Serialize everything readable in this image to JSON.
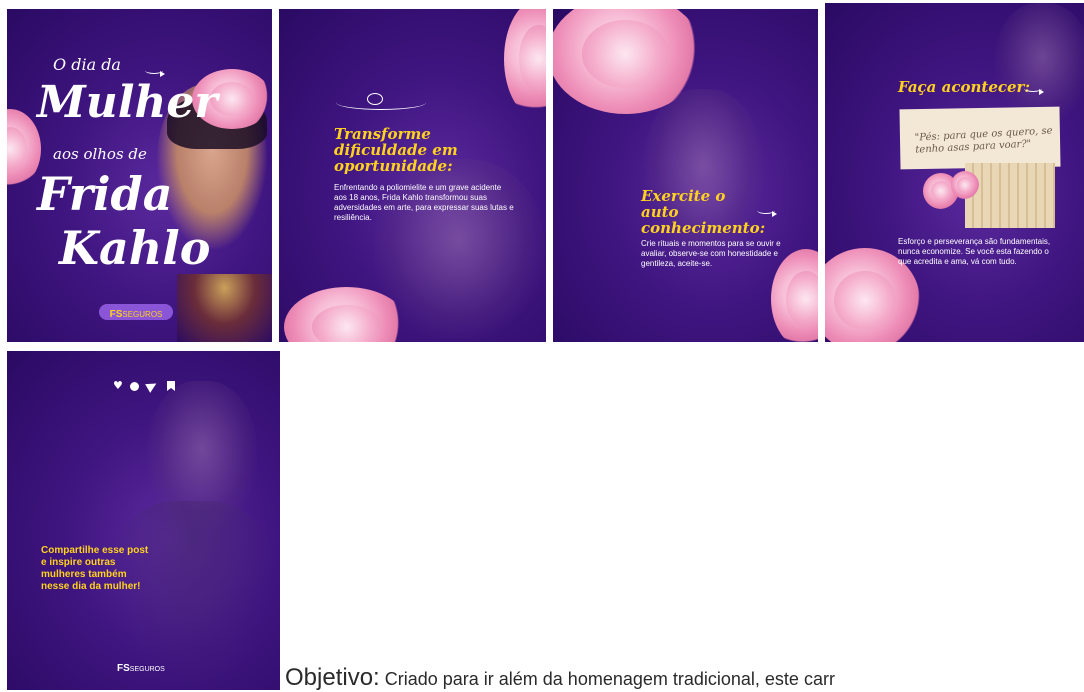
{
  "slide1": {
    "line1": "O dia da",
    "line2": "Mulher",
    "line3": "aos olhos de",
    "line4": "Frida",
    "line5": "Kahlo",
    "logo_fs": "FS",
    "logo_seguros": "SEGUROS"
  },
  "slide2": {
    "heading": "Transforme dificuldade em oportunidade:",
    "body": "Enfrentando a poliomielite e um grave acidente aos 18 anos, Frida Kahlo transformou suas adversidades em arte, para expressar suas lutas e resiliência."
  },
  "slide3": {
    "heading": "Exercite o auto conhecimento:",
    "body": "Crie rituais e momentos para se ouvir e avaliar, observe-se com honestidade e gentileza, aceite-se."
  },
  "slide4": {
    "heading": "Faça acontecer:",
    "quote": "\"Pés: para que os quero, se tenho asas para voar?\"",
    "body": "Esforço e perseverança são fundamentais, nunca economize. Se você esta fazendo o que acredita e ama, vá com tudo."
  },
  "slide5": {
    "icons": [
      "heart-icon",
      "comment-icon",
      "send-icon",
      "bookmark-icon"
    ],
    "cta": "Compartilhe esse post e inspire outras mulheres também nesse dia da mulher!",
    "logo_fs": "FS",
    "logo_seguros": "SEGUROS"
  },
  "caption": {
    "lead": "Objetivo:",
    "rest": " Criado para ir além da homenagem tradicional, este carr"
  },
  "colors": {
    "purple": "#3f1580",
    "yellow": "#ffd21f",
    "pink": "#f4a9c9"
  }
}
